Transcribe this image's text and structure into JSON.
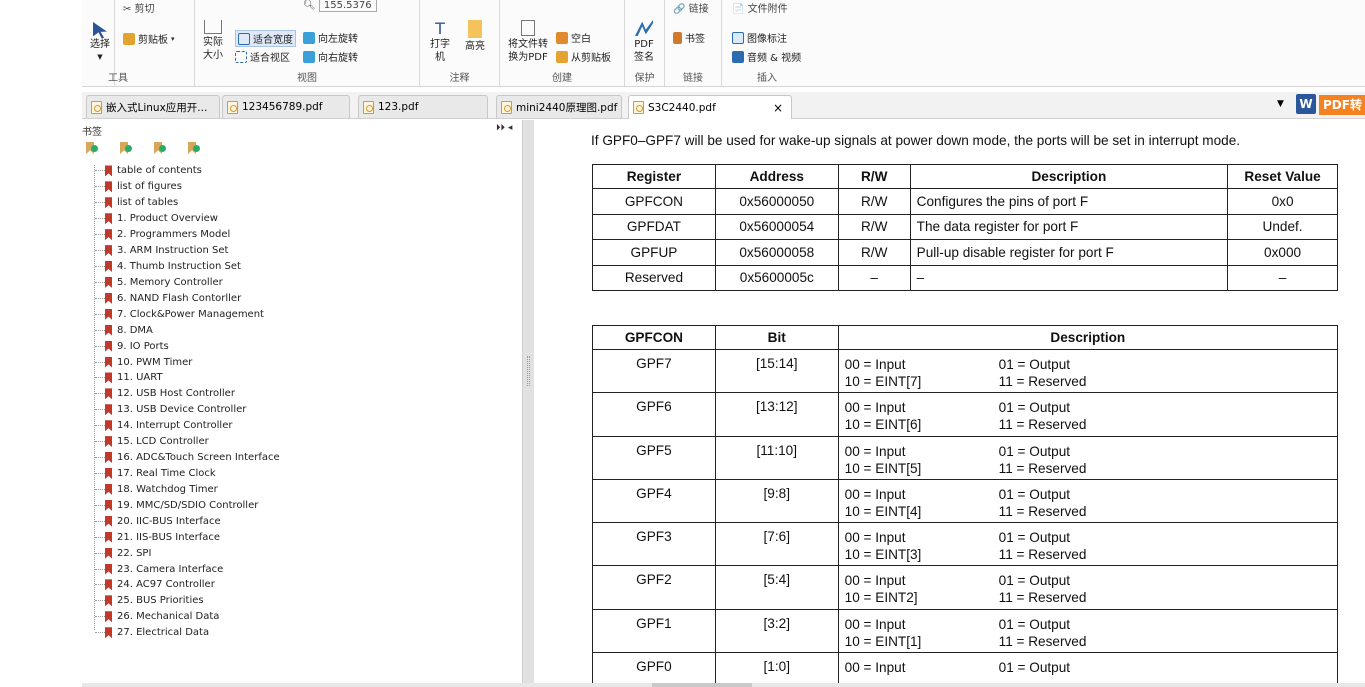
{
  "ribbon": {
    "select_label": "选择",
    "tools_label": "工具",
    "clipboard_label": "剪贴板",
    "actual_size_label": "实际大小",
    "fit_width_label": "适合宽度",
    "fit_view_label": "适合视区",
    "rotate_left_label": "向左旋转",
    "rotate_right_label": "向右旋转",
    "zoom_value": "155.5376",
    "view_label": "视图",
    "typewriter_label": "打字机",
    "highlight_label": "高亮",
    "comment_label": "注释",
    "convert_label": "将文件转换为PDF",
    "blank_label": "空白",
    "from_clipboard_label": "从剪贴板",
    "create_label": "创建",
    "pdf_sign_label": "PDF签名",
    "protect_label": "保护",
    "bookmark_btn_label": "书签",
    "link_label": "链接",
    "image_annot_label": "图像标注",
    "audio_video_label": "音频 & 视频",
    "insert_label": "插入"
  },
  "tabs": [
    {
      "label": "嵌入式Linux应用开..."
    },
    {
      "label": "123456789.pdf"
    },
    {
      "label": "123.pdf"
    },
    {
      "label": "mini2440原理图.pdf"
    },
    {
      "label": "S3C2440.pdf",
      "close": "×"
    }
  ],
  "word_icon": "W",
  "pdf_convert": "PDF转",
  "bookmarks": {
    "title": "书签",
    "collapse": "⏵⏵ ◂",
    "items": [
      "table of contents",
      "list of figures",
      "list of tables",
      "1. Product Overview",
      "2. Programmers Model",
      "3. ARM Instruction Set",
      "4. Thumb Instruction Set",
      "5. Memory Controller",
      "6. NAND Flash Contorller",
      "7. Clock&Power Management",
      "8. DMA",
      "9. IO Ports",
      "10. PWM Timer",
      "11. UART",
      "12. USB Host Controller",
      "13. USB Device Controller",
      "14. Interrupt Controller",
      "15. LCD Controller",
      "16. ADC&Touch Screen Interface",
      "17. Real Time Clock",
      "18. Watchdog Timer",
      "19. MMC/SD/SDIO Controller",
      "20. IIC-BUS Interface",
      "21. IIS-BUS Interface",
      "22. SPI",
      "23. Camera Interface",
      "24. AC97 Controller",
      "25. BUS Priorities",
      "26. Mechanical Data",
      "27. Electrical Data"
    ]
  },
  "document": {
    "intro": "If GPF0–GPF7 will be used for wake-up signals at power down mode, the ports will be set in interrupt mode.",
    "reg_headers": [
      "Register",
      "Address",
      "R/W",
      "Description",
      "Reset Value"
    ],
    "reg_rows": [
      [
        "GPFCON",
        "0x56000050",
        "R/W",
        "Configures the pins of port F",
        "0x0"
      ],
      [
        "GPFDAT",
        "0x56000054",
        "R/W",
        "The data register for port F",
        "Undef."
      ],
      [
        "GPFUP",
        "0x56000058",
        "R/W",
        "Pull-up disable register for port F",
        "0x000"
      ],
      [
        "Reserved",
        "0x5600005c",
        "–",
        "–",
        "–"
      ]
    ],
    "cfg_headers": [
      "GPFCON",
      "Bit",
      "Description"
    ],
    "cfg_rows": [
      {
        "name": "GPF7",
        "bit": "[15:14]",
        "d1a": "00 = Input",
        "d1b": "01 = Output",
        "d2a": "10 = EINT[7]",
        "d2b": "11 = Reserved"
      },
      {
        "name": "GPF6",
        "bit": "[13:12]",
        "d1a": "00 = Input",
        "d1b": "01 = Output",
        "d2a": "10 = EINT[6]",
        "d2b": "11 = Reserved"
      },
      {
        "name": "GPF5",
        "bit": "[11:10]",
        "d1a": "00 = Input",
        "d1b": "01 = Output",
        "d2a": "10 = EINT[5]",
        "d2b": "11 = Reserved"
      },
      {
        "name": "GPF4",
        "bit": "[9:8]",
        "d1a": "00 = Input",
        "d1b": "01 = Output",
        "d2a": "10 = EINT[4]",
        "d2b": "11 = Reserved"
      },
      {
        "name": "GPF3",
        "bit": "[7:6]",
        "d1a": "00 = Input",
        "d1b": "01 = Output",
        "d2a": "10 = EINT[3]",
        "d2b": "11 = Reserved"
      },
      {
        "name": "GPF2",
        "bit": "[5:4]",
        "d1a": "00 = Input",
        "d1b": "01 = Output",
        "d2a": "10 = EINT2]",
        "d2b": "11 = Reserved"
      },
      {
        "name": "GPF1",
        "bit": "[3:2]",
        "d1a": "00 = Input",
        "d1b": "01 = Output",
        "d2a": "10 = EINT[1]",
        "d2b": "11 = Reserved"
      },
      {
        "name": "GPF0",
        "bit": "[1:0]",
        "d1a": "00 = Input",
        "d1b": "01 = Output",
        "d2a": "",
        "d2b": ""
      }
    ]
  },
  "colors": {
    "accent": "#2b579a",
    "convert": "#f58220",
    "bookmark": "#c0392b"
  }
}
